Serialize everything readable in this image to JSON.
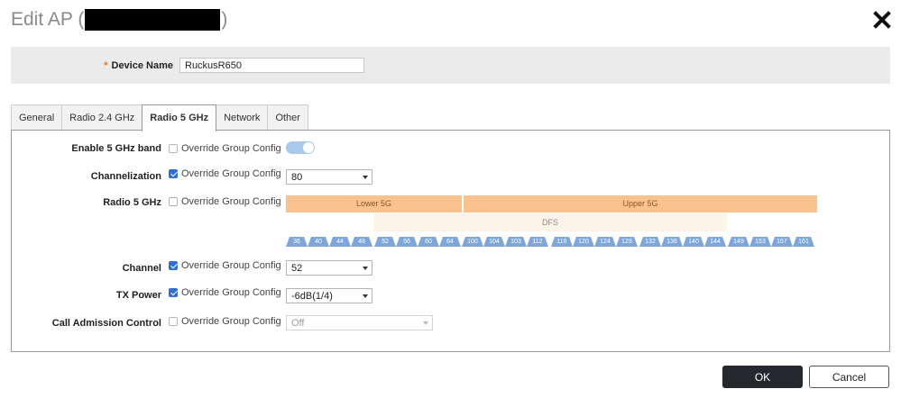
{
  "dialog": {
    "title_prefix": "Edit AP (",
    "title_suffix": ")"
  },
  "device": {
    "required_mark": "*",
    "name_label": "Device Name",
    "name_value": "RuckusR650"
  },
  "tabs": [
    {
      "label": "General",
      "active": false
    },
    {
      "label": "Radio 2.4 GHz",
      "active": false
    },
    {
      "label": "Radio 5 GHz",
      "active": true
    },
    {
      "label": "Network",
      "active": false
    },
    {
      "label": "Other",
      "active": false
    }
  ],
  "rows": {
    "enable": {
      "label": "Enable 5 GHz band",
      "override_label": "Override Group Config",
      "override_checked": false,
      "toggle_on": true
    },
    "channelization": {
      "label": "Channelization",
      "override_label": "Override Group Config",
      "override_checked": true,
      "value": "80"
    },
    "radio": {
      "label": "Radio 5 GHz",
      "override_label": "Override Group Config",
      "override_checked": false
    },
    "channel": {
      "label": "Channel",
      "override_label": "Override Group Config",
      "override_checked": true,
      "value": "52"
    },
    "txpower": {
      "label": "TX Power",
      "override_label": "Override Group Config",
      "override_checked": true,
      "value": "-6dB(1/4)"
    },
    "cac": {
      "label": "Call Admission Control",
      "override_label": "Override Group Config",
      "override_checked": false,
      "value": "Off",
      "disabled": true
    }
  },
  "spectrum": {
    "lower_label": "Lower 5G",
    "upper_label": "Upper 5G",
    "dfs_label": "DFS",
    "groups": [
      [
        "36",
        "40",
        "44",
        "48"
      ],
      [
        "52",
        "56",
        "60",
        "64"
      ],
      [
        "100",
        "104",
        "103",
        "112"
      ],
      [
        "116",
        "120",
        "124",
        "128"
      ],
      [
        "132",
        "136",
        "140",
        "144"
      ],
      [
        "149",
        "153",
        "157",
        "161"
      ]
    ],
    "colors": {
      "band": "#f9c28e",
      "dfs": "#fdf3e8",
      "channel": "#7ea6d9"
    }
  },
  "footer": {
    "ok_label": "OK",
    "cancel_label": "Cancel"
  }
}
